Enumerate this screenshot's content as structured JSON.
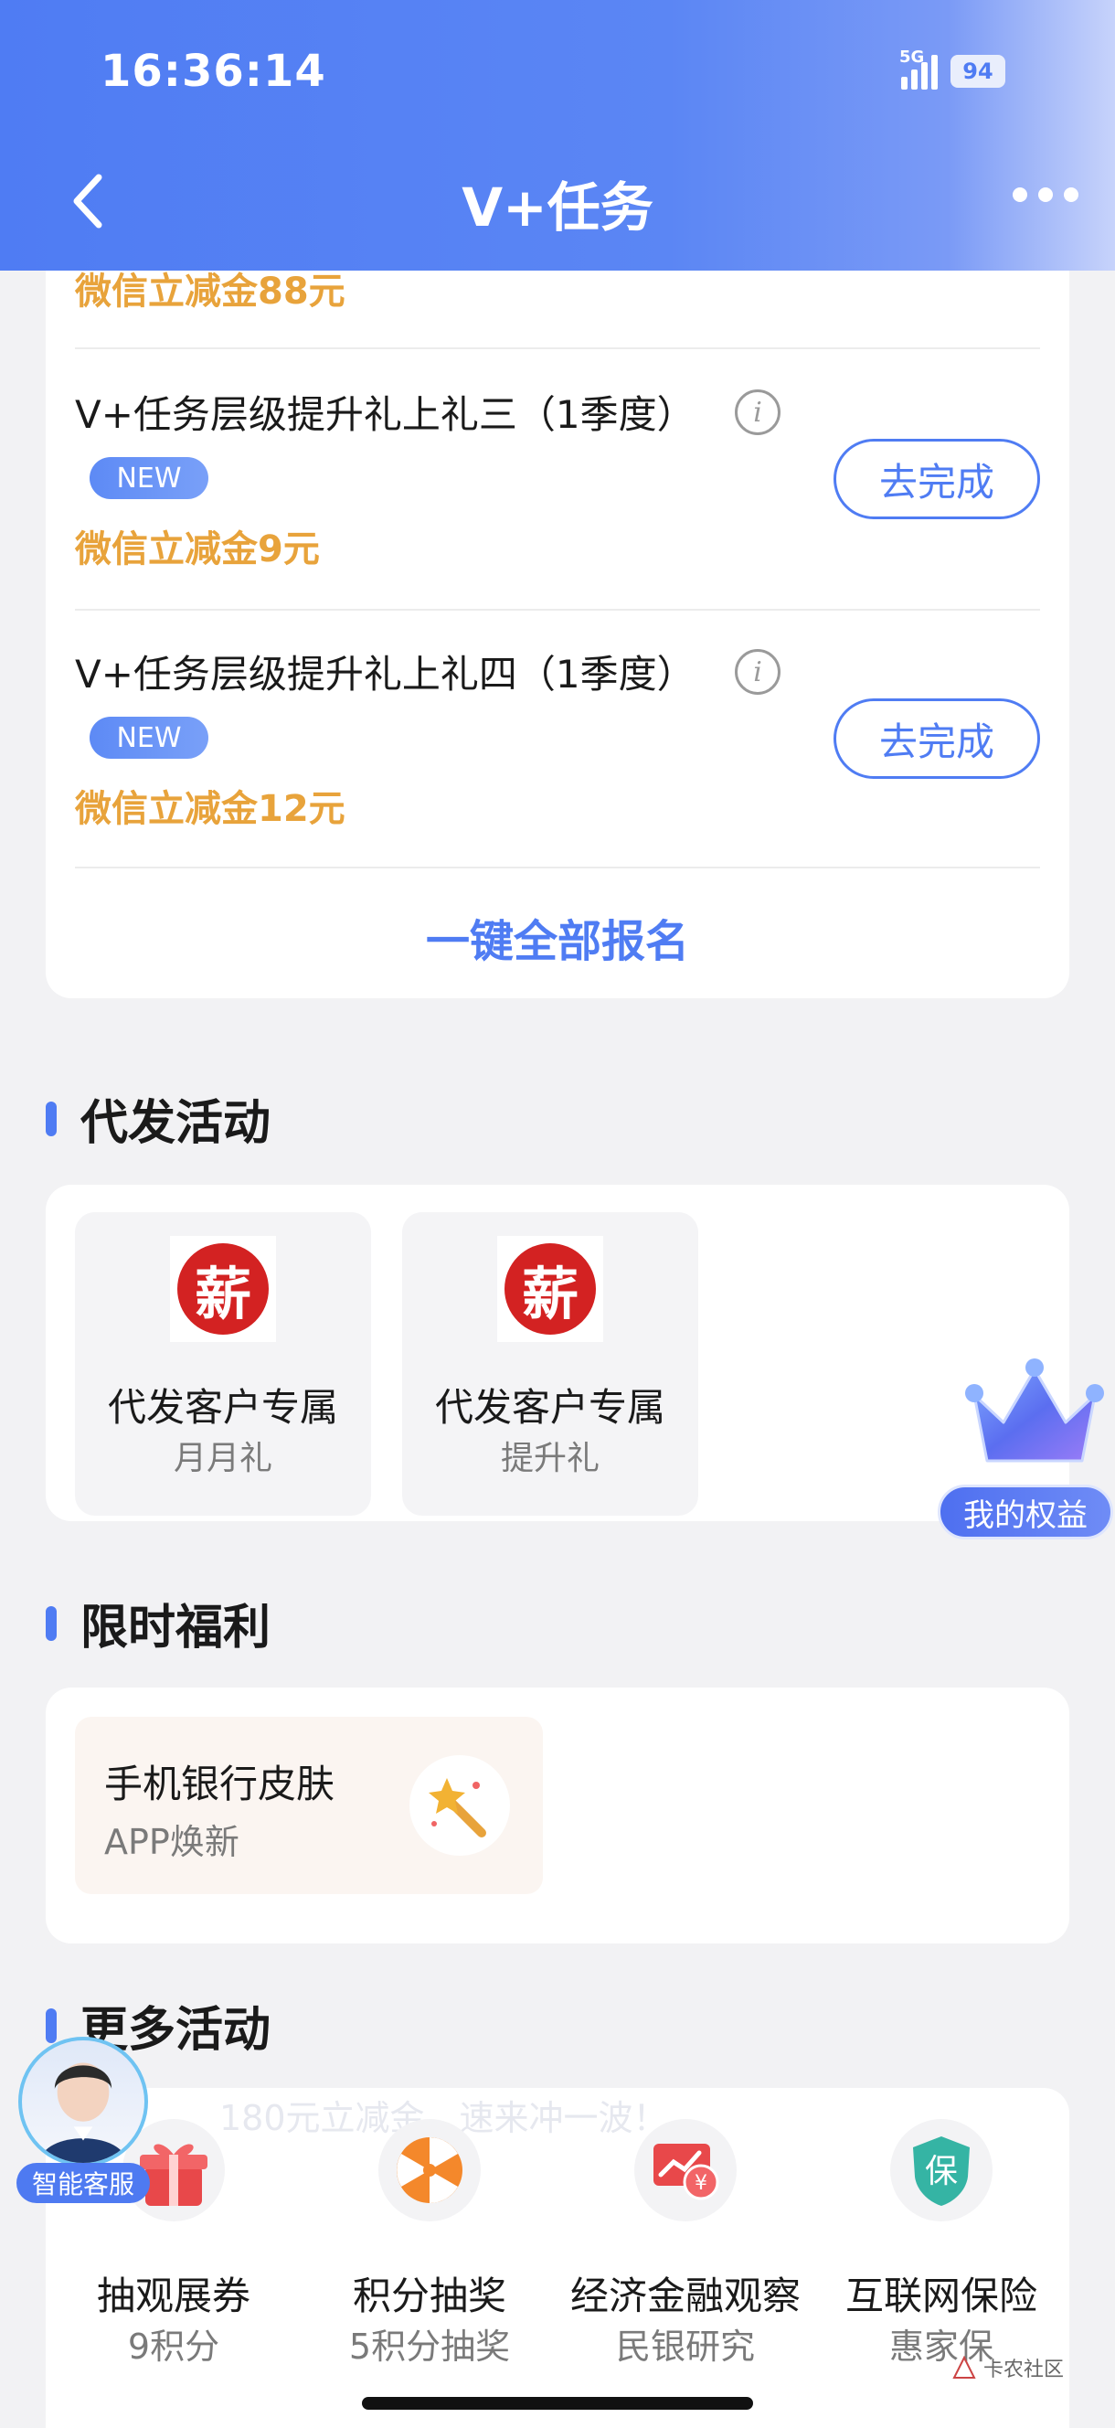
{
  "status_bar": {
    "time": "16:36:14",
    "network": "5G",
    "battery": "94"
  },
  "header": {
    "title": "V+任务"
  },
  "tasks": {
    "partial_reward": "微信立减金88元",
    "items": [
      {
        "title": "V+任务层级提升礼上礼三（1季度）",
        "badge": "NEW",
        "reward": "微信立减金9元",
        "action": "去完成"
      },
      {
        "title": "V+任务层级提升礼上礼四（1季度）",
        "badge": "NEW",
        "reward": "微信立减金12元",
        "action": "去完成"
      }
    ],
    "signup_all": "一键全部报名"
  },
  "daifa": {
    "title": "代发活动",
    "items": [
      {
        "icon_char": "薪",
        "name": "代发客户专属",
        "sub": "月月礼"
      },
      {
        "icon_char": "薪",
        "name": "代发客户专属",
        "sub": "提升礼"
      }
    ]
  },
  "float_benefit": {
    "label": "我的权益"
  },
  "xianshi": {
    "title": "限时福利",
    "item": {
      "title": "手机银行皮肤",
      "sub": "APP焕新"
    }
  },
  "more": {
    "title": "更多活动",
    "marquee": "180元立减金，速来冲一波！",
    "items": [
      {
        "name": "抽观展券",
        "sub": "9积分"
      },
      {
        "name": "积分抽奖",
        "sub": "5积分抽奖"
      },
      {
        "name": "经济金融观察",
        "sub": "民银研究"
      },
      {
        "name": "互联网保险",
        "sub": "惠家保",
        "icon_char": "保"
      }
    ]
  },
  "service_float": {
    "label": "智能客服"
  },
  "watermark": {
    "text": "卡农社区"
  },
  "colors": {
    "primary": "#4f7cf3",
    "reward": "#e8a33b",
    "xin_red": "#d32222"
  }
}
